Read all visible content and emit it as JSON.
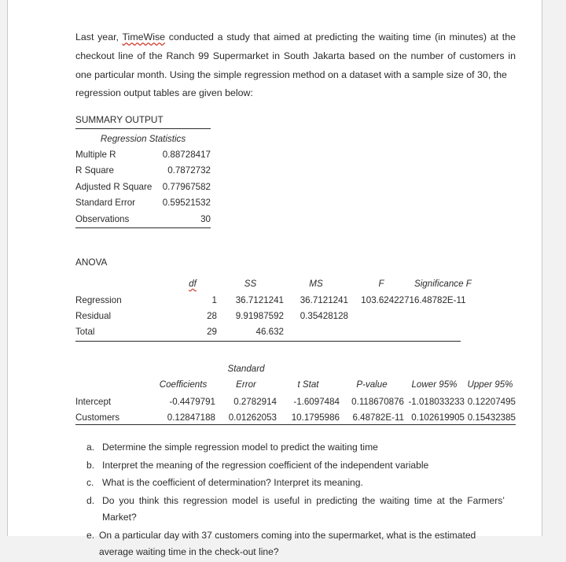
{
  "document": {
    "intro": {
      "before_spell": "Last year, ",
      "spell_word": "TimeWise",
      "after_spell": " conducted a study that aimed at predicting the waiting time (in minutes) at the checkout line of the Ranch 99 Supermarket in South Jakarta based on the number of customers in one particular month. Using the simple regression method on a dataset with a sample size of 30, the",
      "last_line": "regression output tables are given below:"
    },
    "summary": {
      "title": "SUMMARY OUTPUT",
      "caption": "Regression Statistics",
      "rows": [
        {
          "label": "Multiple R",
          "value": "0.88728417"
        },
        {
          "label": "R Square",
          "value": "0.7872732"
        },
        {
          "label": "Adjusted R Square",
          "value": "0.77967582"
        },
        {
          "label": "Standard Error",
          "value": "0.59521532"
        },
        {
          "label": "Observations",
          "value": "30"
        }
      ]
    },
    "anova": {
      "title": "ANOVA",
      "headers": {
        "blank": "",
        "df": "df",
        "ss": "SS",
        "ms": "MS",
        "f": "F",
        "significance_f": "Significance F"
      },
      "rows": [
        {
          "label": "Regression",
          "df": "1",
          "ss": "36.7121241",
          "ms": "36.7121241",
          "f": "103.6242271",
          "significance_f": "6.48782E-11"
        },
        {
          "label": "Residual",
          "df": "28",
          "ss": "9.91987592",
          "ms": "0.35428128",
          "f": "",
          "significance_f": ""
        },
        {
          "label": "Total",
          "df": "29",
          "ss": "46.632",
          "ms": "",
          "f": "",
          "significance_f": ""
        }
      ]
    },
    "coefficients": {
      "headers": {
        "blank": "",
        "coefficients": "Coefficients",
        "standard": "Standard",
        "error": "Error",
        "t_stat": "t Stat",
        "p_value": "P-value",
        "lower_95": "Lower 95%",
        "upper_95": "Upper 95%"
      },
      "rows": [
        {
          "label": "Intercept",
          "coefficient": "-0.4479791",
          "standard_error": "0.2782914",
          "t_stat": "-1.6097484",
          "p_value": "0.118670876",
          "lower_95": "-1.018033233",
          "upper_95": "0.12207495"
        },
        {
          "label": "Customers",
          "coefficient": "0.12847188",
          "standard_error": "0.01262053",
          "t_stat": "10.1795986",
          "p_value": "6.48782E-11",
          "lower_95": "0.102619905",
          "upper_95": "0.15432385"
        }
      ]
    },
    "questions": [
      {
        "marker": "a.",
        "text": "Determine the simple regression model to predict the waiting time"
      },
      {
        "marker": "b.",
        "text": "Interpret the meaning of the regression coefficient of the independent variable"
      },
      {
        "marker": "c.",
        "text": "What is the coefficient of determination? Interpret its meaning."
      },
      {
        "marker": "d.",
        "text": "Do you think this regression model is useful in predicting the waiting time at the Farmers’ Market?"
      },
      {
        "marker": "e.",
        "text": "On a particular day with 37 customers coming into the supermarket, what is the estimated average waiting time in the check-out line?"
      }
    ]
  },
  "colors": {
    "page_background": "#ffffff",
    "outside_background": "#f2f2f2",
    "text": "#2b2b2b",
    "rule": "#2b2b2b",
    "spellcheck_underline": "#d03b2e",
    "page_border": "#c8c8c8"
  }
}
